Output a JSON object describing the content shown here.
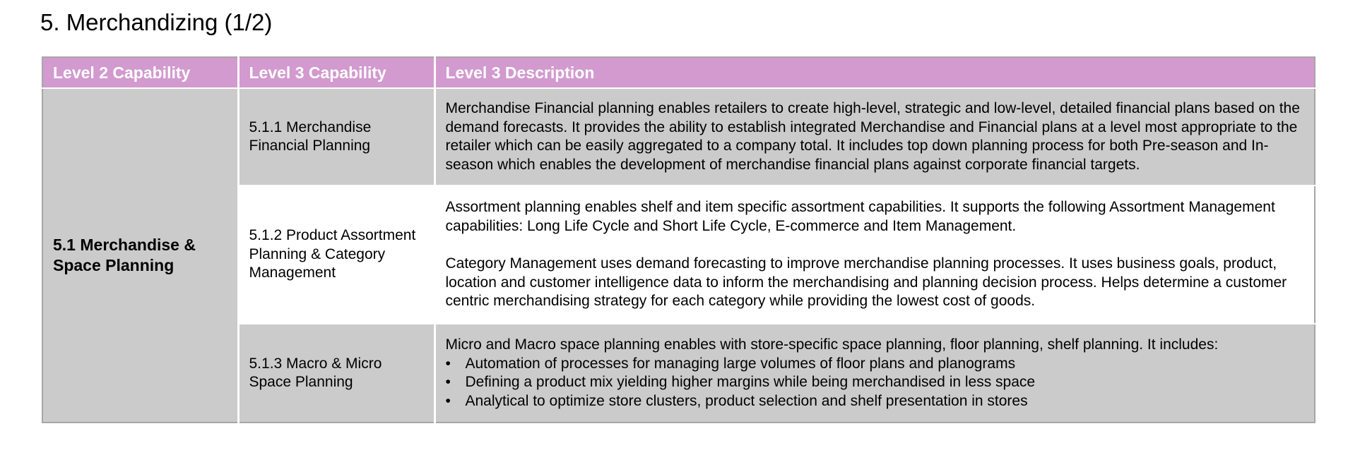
{
  "page_title": "5. Merchandizing (1/2)",
  "table": {
    "headers": [
      "Level 2 Capability",
      "Level 3 Capability",
      "Level 3 Description"
    ],
    "level2": "5.1 Merchandise & Space Planning",
    "rows": [
      {
        "level3": "5.1.1 Merchandise Financial Planning",
        "description": "Merchandise Financial planning enables retailers to create high-level, strategic and low-level, detailed financial plans based on the demand forecasts. It provides the ability to establish integrated Merchandise and Financial plans at a level most appropriate to the retailer which can be easily aggregated to a company total. It includes top down planning process for both Pre-season and In-season which enables the development of merchandise financial plans against corporate financial targets."
      },
      {
        "level3": "5.1.2 Product Assortment Planning & Category Management",
        "description_p1": "Assortment planning enables shelf and item specific assortment capabilities. It supports the following Assortment Management capabilities: Long Life Cycle and Short Life Cycle, E-commerce and Item Management.",
        "description_p2": "Category Management uses demand forecasting to improve merchandise planning processes. It uses business goals, product, location and customer intelligence data to inform the merchandising and planning decision process. Helps determine a customer centric merchandising strategy for each category while providing the lowest cost of goods."
      },
      {
        "level3": "5.1.3 Macro & Micro Space Planning",
        "description_intro": "Micro and Macro space planning enables with store-specific space planning, floor planning, shelf planning. It includes:",
        "bullet_symbol": "•",
        "bullets": [
          "Automation of processes for managing large volumes of floor plans and planograms",
          "Defining a product mix yielding higher margins while being merchandised in less space",
          "Analytical to optimize store clusters, product selection and shelf presentation in stores"
        ]
      }
    ]
  },
  "colors": {
    "header_bg": "#d29acf",
    "header_text": "#ffffff",
    "grey_cell": "#cbcbcb",
    "table_border": "#a6a6a6"
  }
}
